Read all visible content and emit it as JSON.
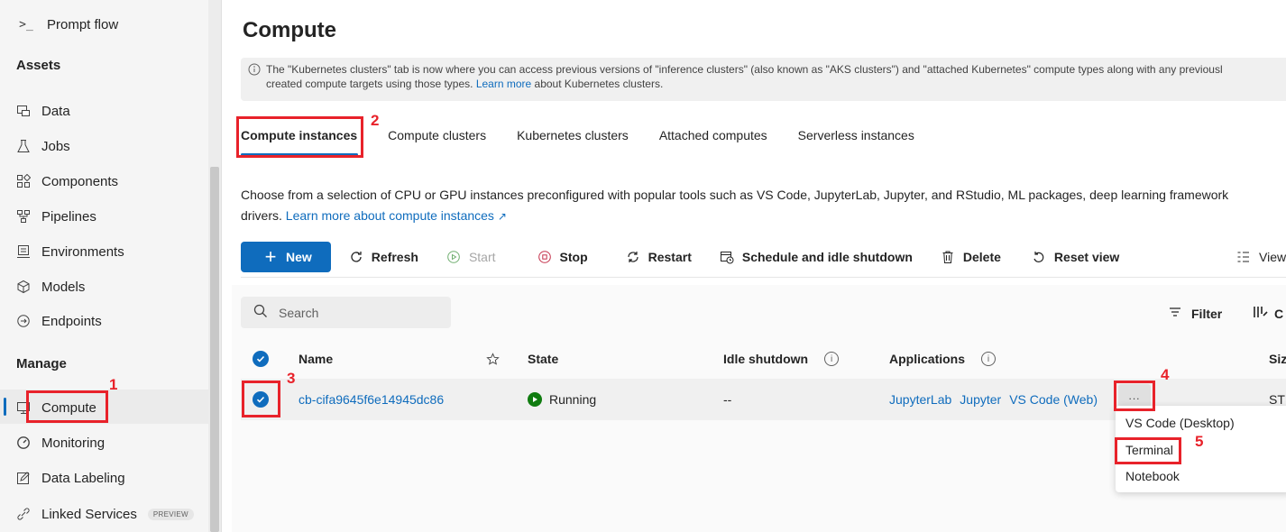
{
  "sidebar": {
    "prompt_flow": "Prompt flow",
    "assets_header": "Assets",
    "assets": [
      {
        "label": "Data",
        "icon": "data-icon"
      },
      {
        "label": "Jobs",
        "icon": "flask-icon"
      },
      {
        "label": "Components",
        "icon": "components-icon"
      },
      {
        "label": "Pipelines",
        "icon": "pipelines-icon"
      },
      {
        "label": "Environments",
        "icon": "environments-icon"
      },
      {
        "label": "Models",
        "icon": "cube-icon"
      },
      {
        "label": "Endpoints",
        "icon": "endpoints-icon"
      }
    ],
    "manage_header": "Manage",
    "manage": [
      {
        "label": "Compute",
        "icon": "desktop-icon"
      },
      {
        "label": "Monitoring",
        "icon": "gauge-icon"
      },
      {
        "label": "Data Labeling",
        "icon": "edit-icon"
      },
      {
        "label": "Linked Services",
        "icon": "link-icon"
      }
    ],
    "preview_badge": "PREVIEW"
  },
  "page": {
    "title": "Compute",
    "banner_text_1": "The \"Kubernetes clusters\" tab is now where you can access previous versions of \"inference clusters\" (also known as \"AKS clusters\") and \"attached Kubernetes\" compute types along with any previousl",
    "banner_text_2a": "created compute targets using those types.",
    "banner_link": "Learn more",
    "banner_text_2b": "about Kubernetes clusters."
  },
  "tabs": [
    "Compute instances",
    "Compute clusters",
    "Kubernetes clusters",
    "Attached computes",
    "Serverless instances"
  ],
  "description": {
    "text": "Choose from a selection of CPU or GPU instances preconfigured with popular tools such as VS Code, JupyterLab, Jupyter, and RStudio, ML packages, deep learning framework",
    "text2": "drivers.",
    "link": "Learn more about compute instances"
  },
  "toolbar": {
    "new": "New",
    "refresh": "Refresh",
    "start": "Start",
    "stop": "Stop",
    "restart": "Restart",
    "schedule": "Schedule and idle shutdown",
    "delete": "Delete",
    "reset_view": "Reset view",
    "view": "View"
  },
  "list": {
    "search_placeholder": "Search",
    "filter": "Filter",
    "columns_short": "C",
    "headers": {
      "name": "Name",
      "state": "State",
      "idle_shutdown": "Idle shutdown",
      "applications": "Applications",
      "size": "Siz"
    },
    "rows": [
      {
        "name": "cb-cifa9645f6e14945dc86",
        "state": "Running",
        "idle_shutdown": "--",
        "apps": [
          "JupyterLab",
          "Jupyter",
          "VS Code (Web)"
        ],
        "more": "...",
        "size": "ST"
      }
    ]
  },
  "more_menu": [
    "VS Code (Desktop)",
    "Terminal",
    "Notebook"
  ],
  "callouts": [
    "1",
    "2",
    "3",
    "4",
    "5"
  ],
  "colors": {
    "accent": "#0f6cbd",
    "running": "#107c10",
    "callout": "#e8222a"
  }
}
